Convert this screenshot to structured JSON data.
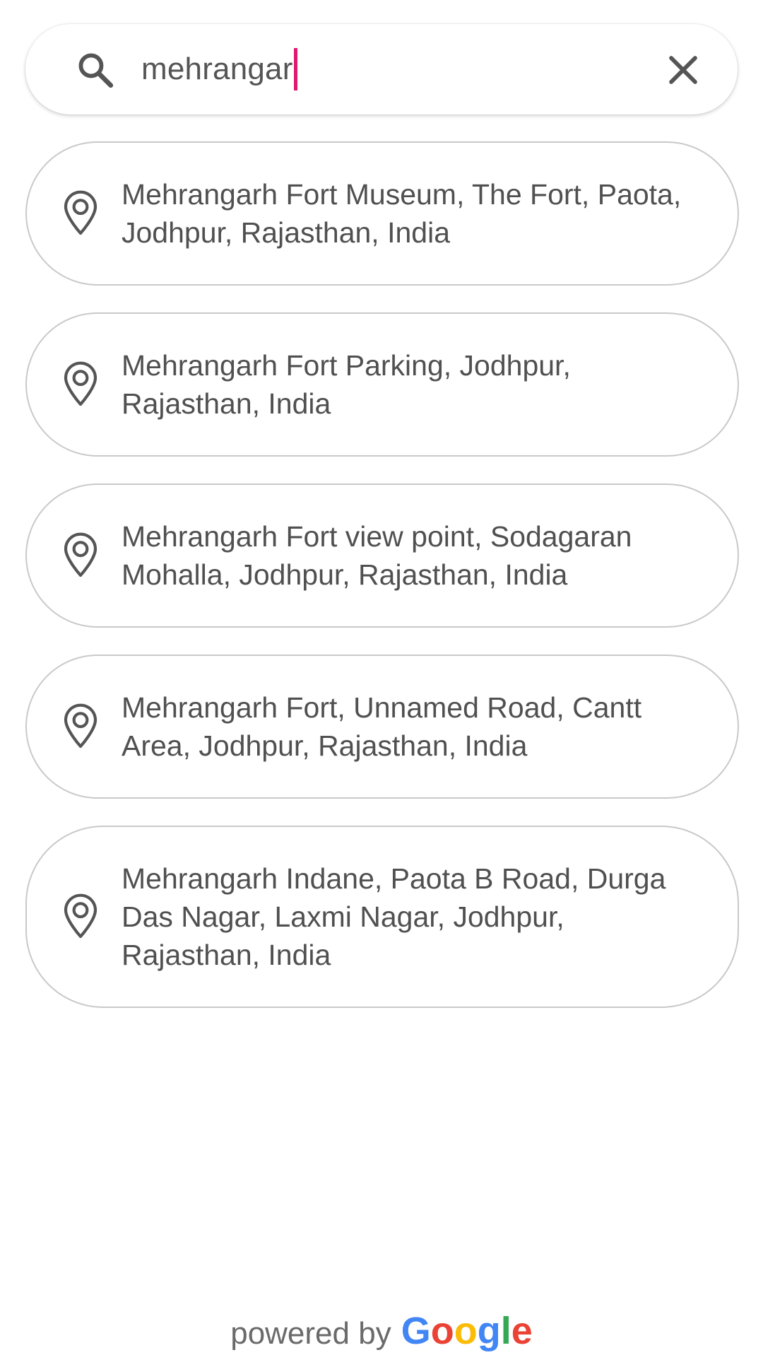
{
  "search": {
    "value": "mehrangar",
    "caret_color": "#e0196e"
  },
  "icons": {
    "search": "search-icon",
    "clear": "close-icon",
    "result": "location-pin-icon"
  },
  "results": [
    {
      "label": "Mehrangarh Fort Museum, The Fort, Paota, Jodhpur, Rajasthan, India"
    },
    {
      "label": "Mehrangarh Fort Parking, Jodhpur, Rajasthan, India"
    },
    {
      "label": "Mehrangarh Fort view point, Sodagaran Mohalla, Jodhpur, Rajasthan, India"
    },
    {
      "label": "Mehrangarh Fort, Unnamed Road, Cantt Area, Jodhpur, Rajasthan, India"
    },
    {
      "label": "Mehrangarh Indane, Paota B Road, Durga Das Nagar, Laxmi Nagar, Jodhpur, Rajasthan, India"
    }
  ],
  "footer": {
    "powered_by": "powered by",
    "logo_text": "Google"
  }
}
